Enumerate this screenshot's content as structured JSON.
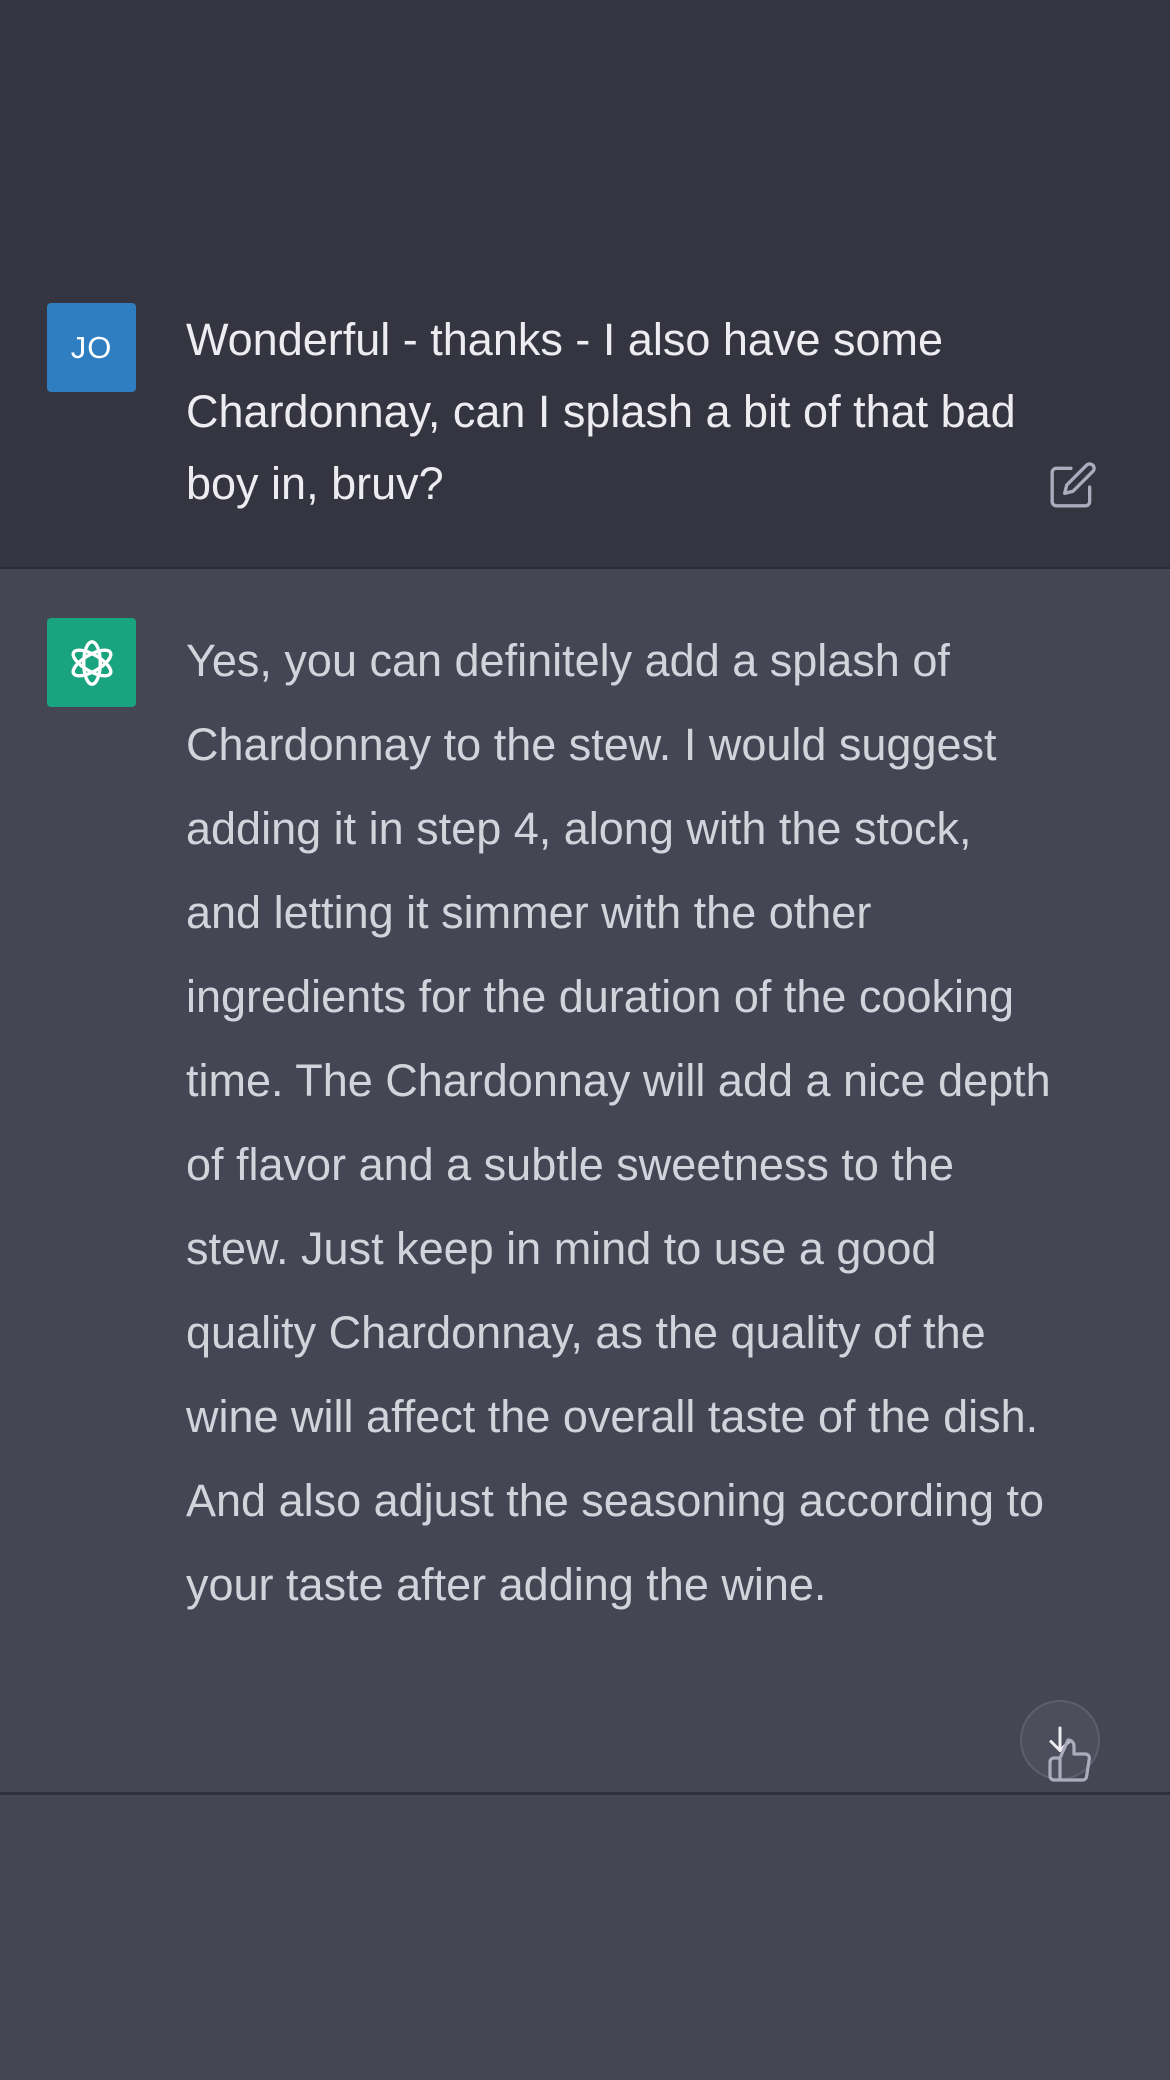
{
  "user_message": {
    "avatar_initials": "JO",
    "text": "Wonderful - thanks - I also have some Chardonnay, can I splash a bit of that bad boy in, bruv?",
    "edit_icon": "edit-icon"
  },
  "assistant_message": {
    "avatar_icon": "openai-logo-icon",
    "text": "Yes, you can definitely add a splash of Chardonnay to the stew. I would suggest adding it in step 4, along with the stock, and letting it simmer with the other ingredients for the duration of the cooking time. The Chardonnay will add a nice depth of flavor and a subtle sweetness to the stew. Just keep in mind to use a good quality Chardonnay, as the quality of the wine will affect the overall taste of the dish. And also adjust the seasoning according to your taste after adding the wine.",
    "feedback_icon": "thumbs-up-icon"
  },
  "controls": {
    "scroll_down_icon": "arrow-down-icon"
  },
  "colors": {
    "user_background": "#343541",
    "assistant_background": "#444654",
    "user_avatar": "#2f7ec1",
    "bot_avatar": "#19a37f"
  }
}
